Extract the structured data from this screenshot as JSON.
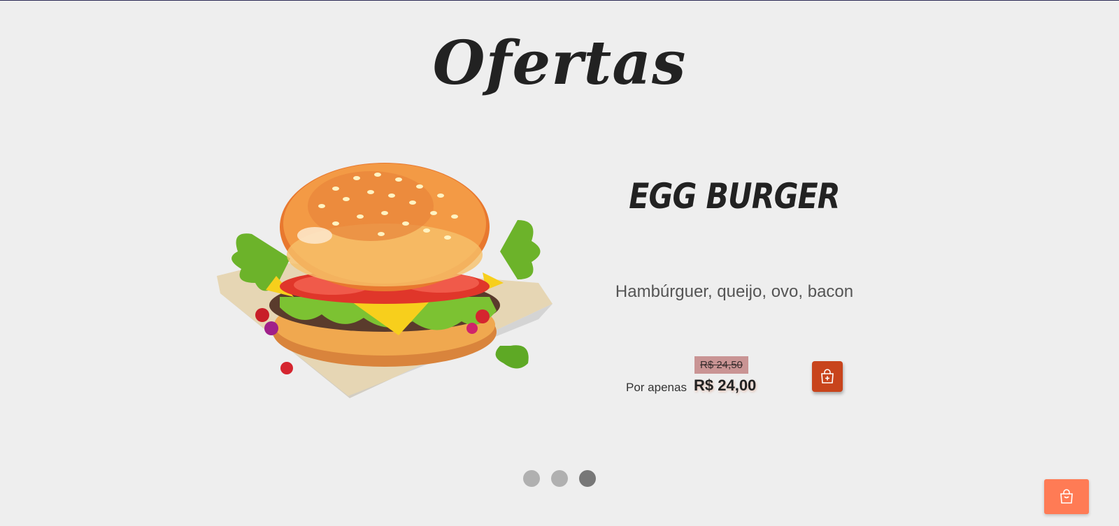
{
  "page": {
    "title": "Ofertas"
  },
  "offer": {
    "image_name": "egg-burger-image",
    "name": "EGG BURGER",
    "description": "Hambúrguer, queijo, ovo, bacon",
    "old_price": "R$ 24,50",
    "price_prefix": "Por apenas",
    "price": "R$ 24,00",
    "add_icon": "shopping-bag-plus-icon"
  },
  "carousel": {
    "slides": 3,
    "active_index": 2
  },
  "cart_button": {
    "icon": "shopping-bag-icon"
  },
  "colors": {
    "background": "#eeeeee",
    "accent": "#c8441c",
    "cart_button": "#ff7b55",
    "old_price_bg": "#c99494"
  }
}
